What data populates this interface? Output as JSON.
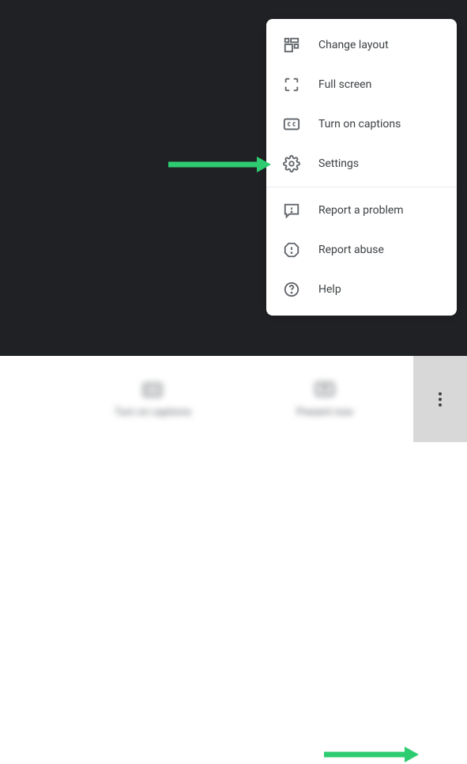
{
  "menu": {
    "items": [
      {
        "icon": "layout",
        "label": "Change layout"
      },
      {
        "icon": "fullscreen",
        "label": "Full screen"
      },
      {
        "icon": "cc",
        "label": "Turn on captions"
      },
      {
        "icon": "gear",
        "label": "Settings"
      }
    ],
    "itemsSecondary": [
      {
        "icon": "report",
        "label": "Report a problem"
      },
      {
        "icon": "abuse",
        "label": "Report abuse"
      },
      {
        "icon": "help",
        "label": "Help"
      }
    ]
  },
  "bottomBar": {
    "captions": {
      "label": "Turn on captions"
    },
    "present": {
      "label": "Present now"
    }
  },
  "colors": {
    "arrow": "#2ecc71",
    "darkBg": "#202124",
    "iconGray": "#5f6368",
    "textGray": "#3c4043"
  }
}
